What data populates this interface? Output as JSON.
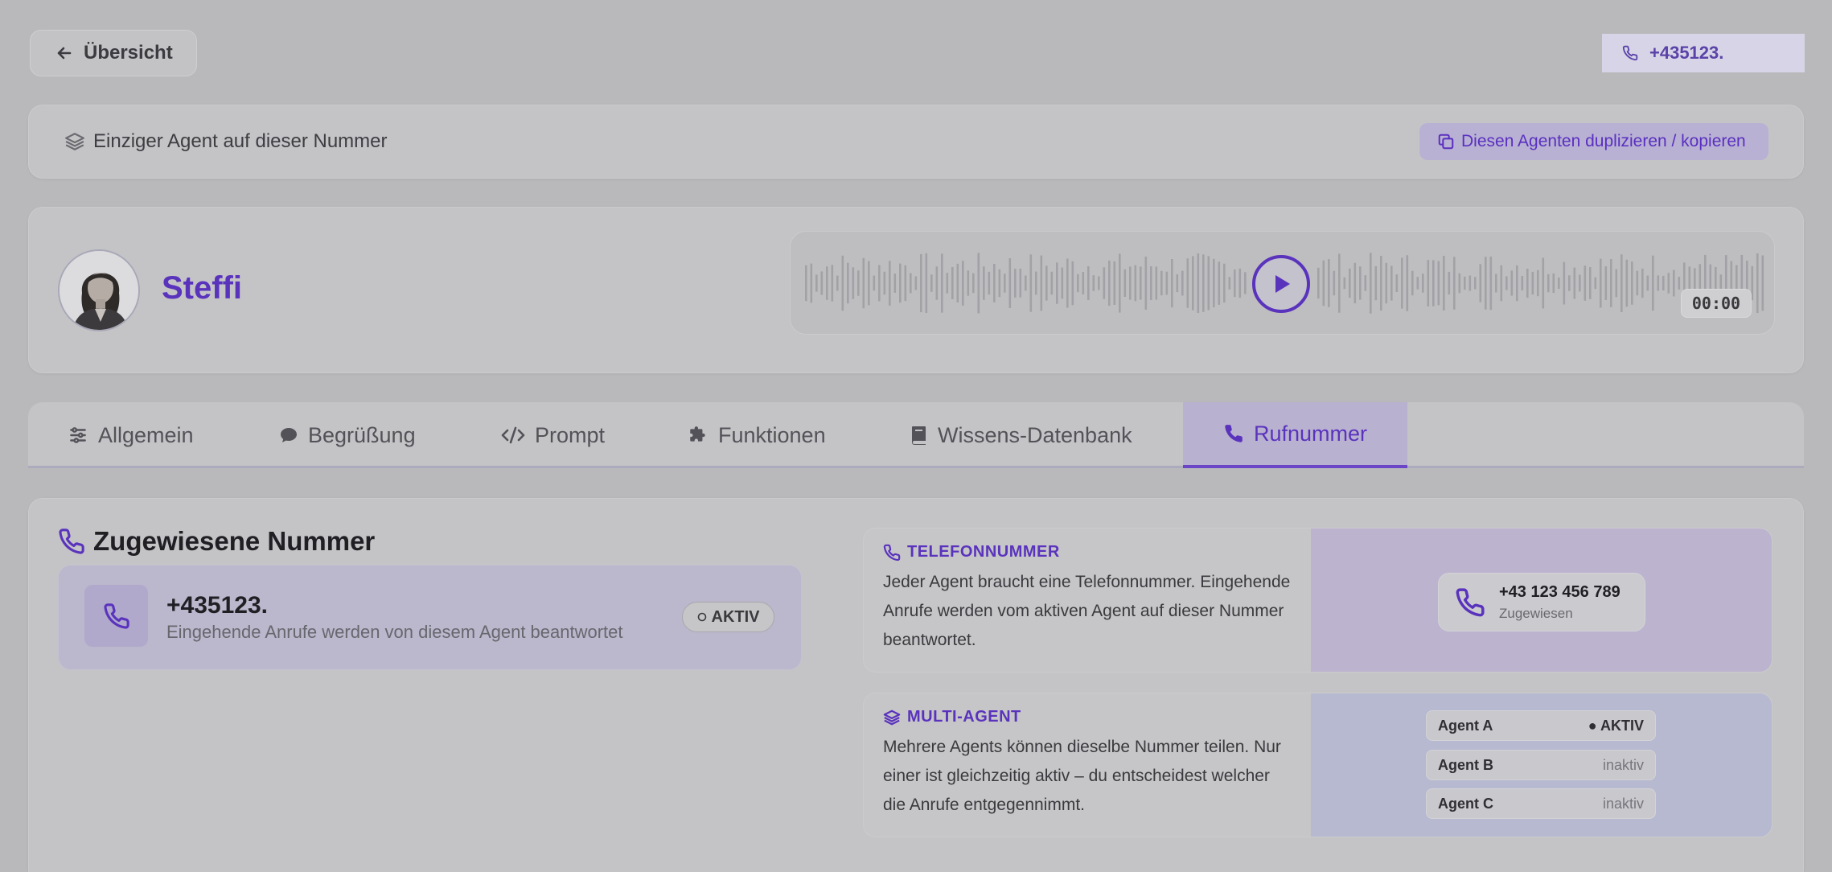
{
  "header": {
    "back_label": "Übersicht",
    "phone_number": "+435123."
  },
  "banner": {
    "text": "Einziger Agent auf dieser Nummer",
    "duplicate_label": "Diesen Agenten duplizieren / kopieren"
  },
  "agent": {
    "name": "Steffi",
    "player_time": "00:00"
  },
  "tabs": [
    {
      "label": "Allgemein",
      "icon": "sliders-icon"
    },
    {
      "label": "Begrüßung",
      "icon": "chat-bubble-icon"
    },
    {
      "label": "Prompt",
      "icon": "code-icon"
    },
    {
      "label": "Funktionen",
      "icon": "puzzle-icon"
    },
    {
      "label": "Wissens-Datenbank",
      "icon": "book-icon"
    },
    {
      "label": "Rufnummer",
      "icon": "phone-icon",
      "active": true
    }
  ],
  "assigned": {
    "title": "Zugewiesene Nummer",
    "number": "+435123.",
    "subtitle": "Eingehende Anrufe werden von diesem Agent beantwortet",
    "badge": "AKTIV"
  },
  "info_telefon": {
    "heading": "TELEFONNUMMER",
    "body": "Jeder Agent braucht eine Telefonnummer. Eingehende Anrufe werden vom aktiven Agent auf dieser Nummer beantwortet.",
    "example_number": "+43 123 456 789",
    "example_status": "Zugewiesen"
  },
  "info_multi": {
    "heading": "MULTI-AGENT",
    "body": "Mehrere Agents können dieselbe Nummer teilen. Nur einer ist gleichzeitig aktiv – du entscheidest welcher die Anrufe entgegennimmt.",
    "agents": [
      {
        "name": "Agent A",
        "status": "● AKTIV",
        "active": true
      },
      {
        "name": "Agent B",
        "status": "inaktiv",
        "active": false
      },
      {
        "name": "Agent C",
        "status": "inaktiv",
        "active": false
      }
    ]
  },
  "colors": {
    "accent": "#5a33bd",
    "background_overlay": "#b9b9bb"
  }
}
